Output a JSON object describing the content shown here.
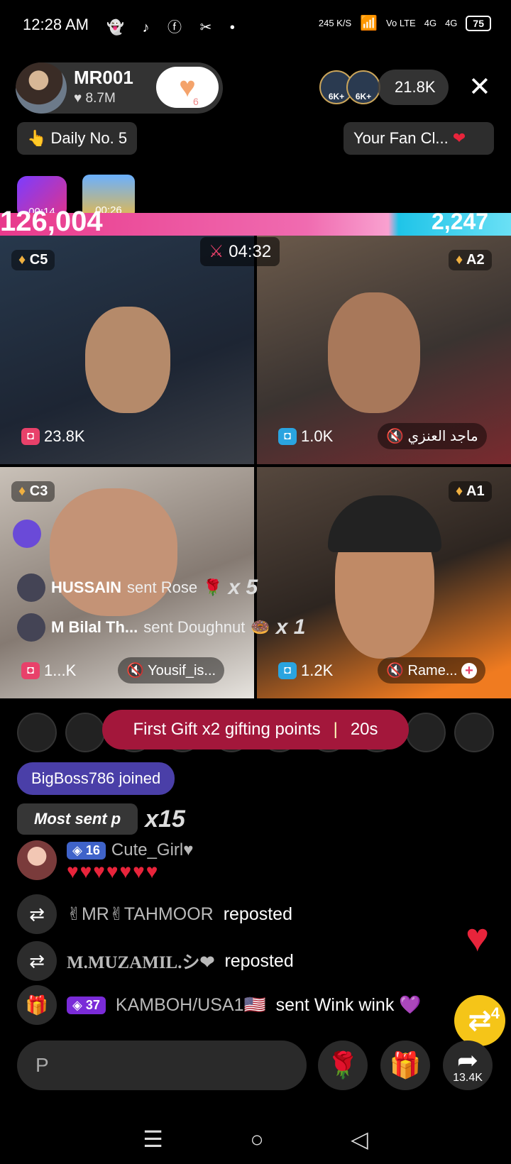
{
  "status_bar": {
    "time": "12:28 AM",
    "notif_icons": [
      "snapchat-icon",
      "tiktok-icon",
      "facebook-icon",
      "capcut-icon",
      "dot-icon"
    ],
    "net_speed": "245 K/S",
    "volte": "Vo LTE",
    "signal1": "4G",
    "signal2": "4G",
    "battery": "75"
  },
  "host": {
    "name": "MR001",
    "likes": "♥ 8.7M",
    "follow_count": "6"
  },
  "viewers": {
    "badge1": "6K+",
    "badge2": "6K+",
    "count": "21.8K"
  },
  "daily": "👆 Daily No. 5",
  "fan_club": "Your Fan Cl...",
  "badges": {
    "timer1": "00:14",
    "timer2": "00:26"
  },
  "battle": {
    "left_score": "126,004",
    "right_score": "2,247",
    "timer": "04:32"
  },
  "tiles": [
    {
      "rank": "C5",
      "views": "23.8K",
      "label": ""
    },
    {
      "rank": "A2",
      "views": "1.0K",
      "label": "ماجد العنزي"
    },
    {
      "rank": "C3",
      "views": "1...K",
      "label": "Yousif_is..."
    },
    {
      "rank": "A1",
      "views": "1.2K",
      "label": "Rame..."
    }
  ],
  "gifts": [
    {
      "name": "HUSSAIN",
      "action": "sent Rose",
      "icon": "🌹",
      "count": "x 5"
    },
    {
      "name": "M Bilal Th...",
      "action": "sent Doughnut",
      "icon": "🍩",
      "count": "x 1"
    }
  ],
  "promo": {
    "text": "First Gift x2 gifting points",
    "time": "20s"
  },
  "chat": {
    "joined": "BigBoss786 joined",
    "most_sent_label": "Most sent p",
    "most_sent_count": "x15",
    "message1": {
      "level": "16",
      "name": "Cute_Girl♥",
      "text": "♥♥♥♥♥♥♥"
    },
    "repost1_name": "✌MR✌TAHMOOR",
    "repost1_action": "reposted",
    "repost2_name": "M.MUZAMIL.シ❤",
    "repost2_action": "reposted",
    "gift_level": "37",
    "gift_name": "KAMBOH/USA1🇺🇸",
    "gift_action": "sent Wink wink 💜"
  },
  "repost_button_count": "4",
  "input_placeholder": "P",
  "share_count": "13.4K",
  "colors": {
    "battle_left": "#e83a8c",
    "battle_right": "#1fc4e8",
    "promo": "#a3173b",
    "joined": "#4a3fa8",
    "heart": "#e8243b"
  }
}
